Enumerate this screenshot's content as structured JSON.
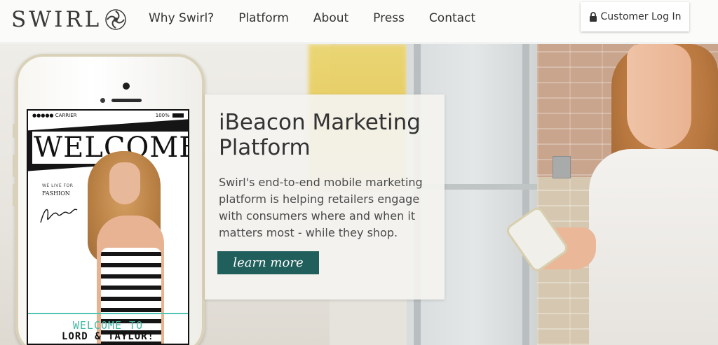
{
  "brand": {
    "logo_text": "SWIRL",
    "logo_icon": "swirl-logo-icon"
  },
  "nav": {
    "items": [
      {
        "label": "Why Swirl?"
      },
      {
        "label": "Platform"
      },
      {
        "label": "About"
      },
      {
        "label": "Press"
      },
      {
        "label": "Contact"
      }
    ]
  },
  "login": {
    "label": "Customer Log In",
    "icon": "lock-icon"
  },
  "hero": {
    "title": "iBeacon Marketing Platform",
    "body": "Swirl's end-to-end mobile marketing platform is helping retailers engage with consumers where and when it matters most - while they shop.",
    "cta_label": "learn more",
    "cta_color": "#215f5c"
  },
  "phone_screen": {
    "carrier": "●●●●● CARRIER",
    "battery": "100%",
    "welcome_banner": "WELCOME",
    "tagline": "WE LIVE FOR",
    "tagline_bold": "FASHION",
    "welcome_to": "WELCOME TO",
    "store_name": "LORD & TAYLOR!"
  },
  "colors": {
    "accent": "#215f5c",
    "teal_text": "#3fb6a3",
    "header_bg": "#fbfbf9"
  }
}
